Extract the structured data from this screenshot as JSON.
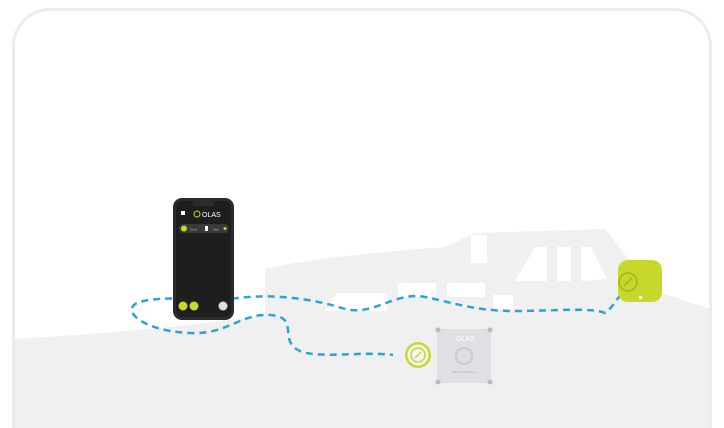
{
  "illustration": {
    "phone": {
      "brand": "OLAS",
      "status_items": [
        "Crew",
        "Alert"
      ],
      "colors": {
        "screen": "#1e1e1e",
        "accent": "#c6d82a",
        "frame": "#2b2b2b"
      }
    },
    "base_station": {
      "brand": "OLAS",
      "caption": "Marine Exchange",
      "colors": {
        "panel": "#dfe0e3",
        "icon": "#c9cbd0"
      }
    },
    "wristband": {
      "icon": "olas-tag-icon",
      "colors": {
        "body": "#c6d82a",
        "strap": "#4a4a4a"
      }
    },
    "tag_puck": {
      "icon": "olas-tag-icon",
      "colors": {
        "ring": "#c6d82a"
      }
    },
    "signal_path": {
      "color": "#2ea1db",
      "style": "dashed"
    },
    "boat": {
      "color": "#f0f0f0"
    }
  }
}
